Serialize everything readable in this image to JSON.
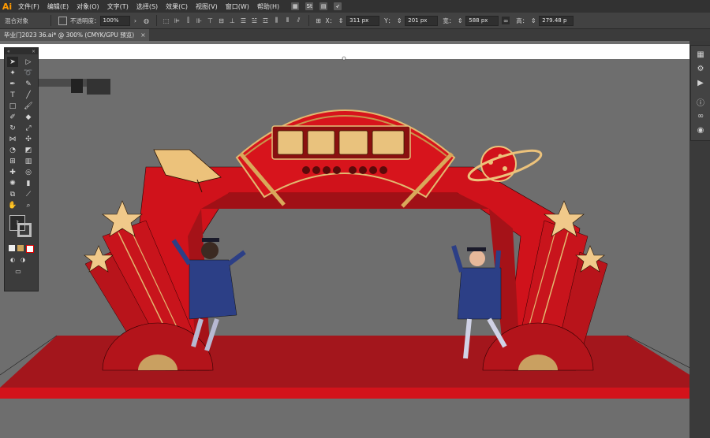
{
  "app": {
    "logo": "Ai"
  },
  "menu": [
    "文件(F)",
    "编辑(E)",
    "对象(O)",
    "文字(T)",
    "选择(S)",
    "效果(C)",
    "视图(V)",
    "窗口(W)",
    "帮助(H)"
  ],
  "menu_icons": {
    "st": "St"
  },
  "control": {
    "object_label": "混合对象",
    "opacity_label": "不透明度：",
    "opacity_value": "100%",
    "x_label": "X：",
    "x_value": "311 px",
    "y_label": "Y：",
    "y_value": "201 px",
    "w_label": "宽：",
    "w_value": "588 px",
    "h_label": "高：",
    "h_value": "279.48 p"
  },
  "tab": {
    "title": "毕业门2023 36.ai* @ 300% (CMYK/GPU 预览)",
    "close": "×"
  },
  "colors": {
    "red": "#d0121b",
    "dark_red": "#8e1418",
    "gold": "#d9a85a",
    "floor": "#a8191e"
  }
}
